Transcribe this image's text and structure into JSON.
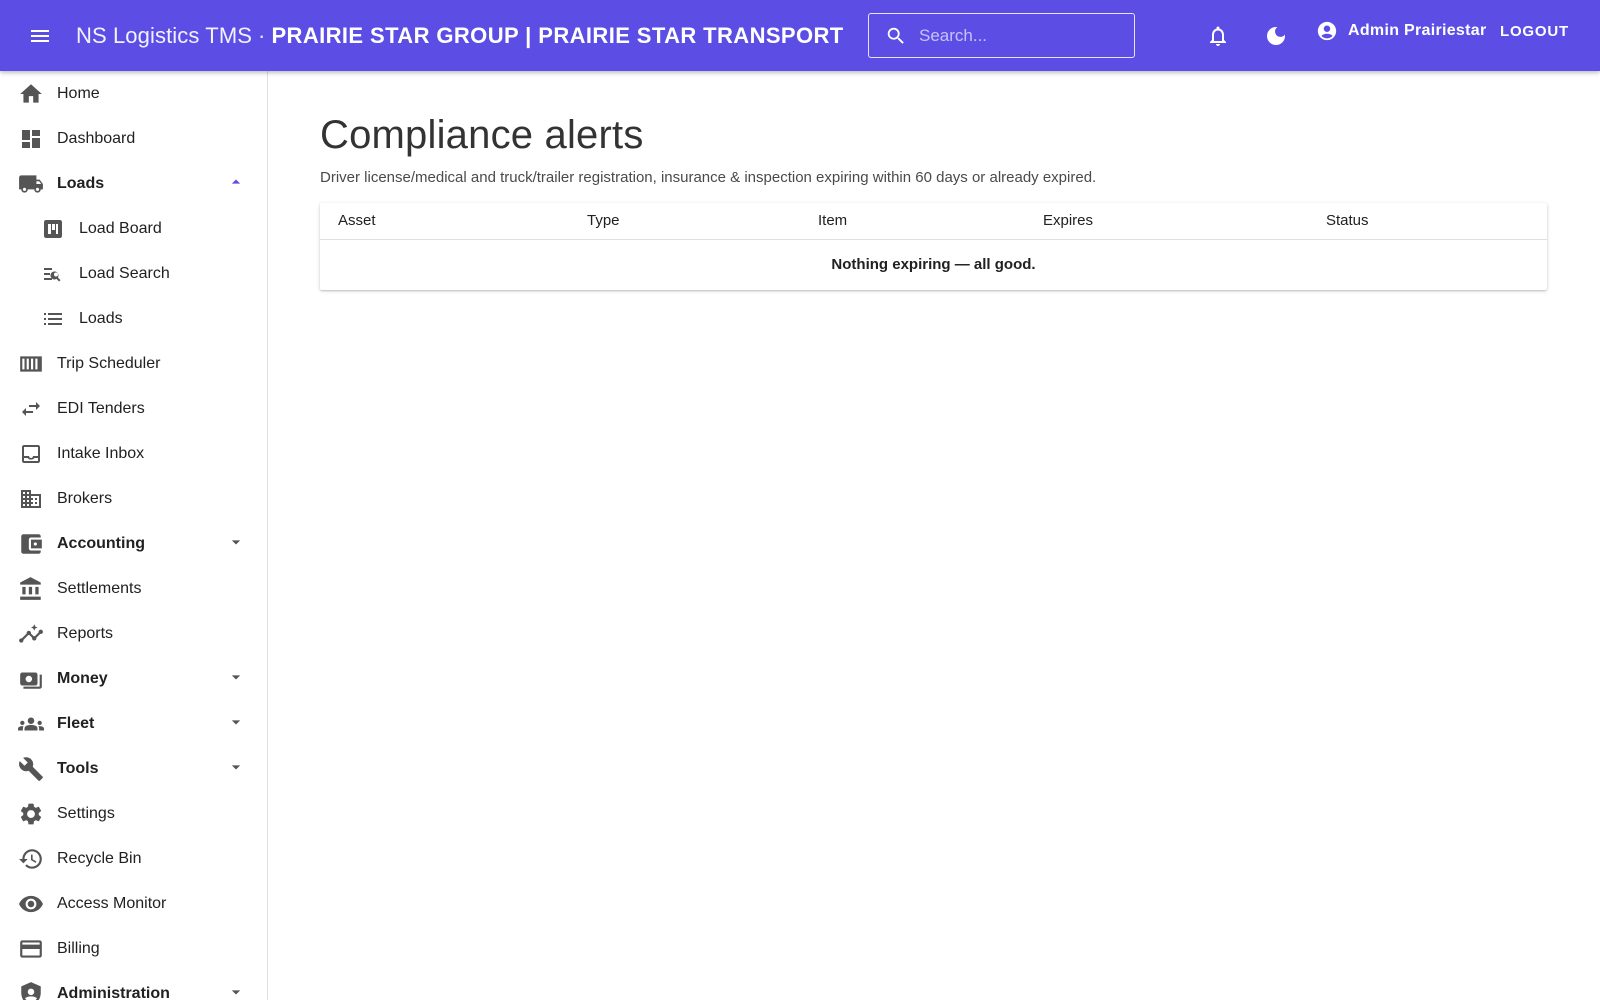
{
  "header": {
    "brand": "NS Logistics TMS",
    "separator": "·",
    "tenant": "PRAIRIE STAR GROUP | PRAIRIE STAR TRANSPORT",
    "search_placeholder": "Search...",
    "user_name": "Admin Prairiestar",
    "logout_label": "LOGOUT",
    "accent_color": "#5c4ee5"
  },
  "sidebar": {
    "items": [
      {
        "label": "Home",
        "icon": "home-icon"
      },
      {
        "label": "Dashboard",
        "icon": "dashboard-icon"
      },
      {
        "label": "Loads",
        "icon": "truck-icon",
        "expanded": true
      },
      {
        "label": "Load Board",
        "icon": "board-icon"
      },
      {
        "label": "Load Search",
        "icon": "list-search-icon"
      },
      {
        "label": "Loads",
        "icon": "list-icon"
      },
      {
        "label": "Trip Scheduler",
        "icon": "calendar-view-icon"
      },
      {
        "label": "EDI Tenders",
        "icon": "swap-icon"
      },
      {
        "label": "Intake Inbox",
        "icon": "inbox-icon"
      },
      {
        "label": "Brokers",
        "icon": "business-icon"
      },
      {
        "label": "Accounting",
        "icon": "wallet-icon",
        "expanded": false
      },
      {
        "label": "Settlements",
        "icon": "bank-icon"
      },
      {
        "label": "Reports",
        "icon": "insights-icon"
      },
      {
        "label": "Money",
        "icon": "money-icon",
        "expanded": false
      },
      {
        "label": "Fleet",
        "icon": "people-icon",
        "expanded": false
      },
      {
        "label": "Tools",
        "icon": "wrench-icon",
        "expanded": false
      },
      {
        "label": "Settings",
        "icon": "gear-icon"
      },
      {
        "label": "Recycle Bin",
        "icon": "history-icon"
      },
      {
        "label": "Access Monitor",
        "icon": "eye-icon"
      },
      {
        "label": "Billing",
        "icon": "credit-card-icon"
      },
      {
        "label": "Administration",
        "icon": "admin-shield-icon",
        "expanded": false
      }
    ]
  },
  "main": {
    "title": "Compliance alerts",
    "description": "Driver license/medical and truck/trailer registration, insurance & inspection expiring within 60 days or already expired.",
    "table": {
      "columns": [
        "Asset",
        "Type",
        "Item",
        "Expires",
        "Status"
      ],
      "empty_message": "Nothing expiring — all good."
    }
  }
}
